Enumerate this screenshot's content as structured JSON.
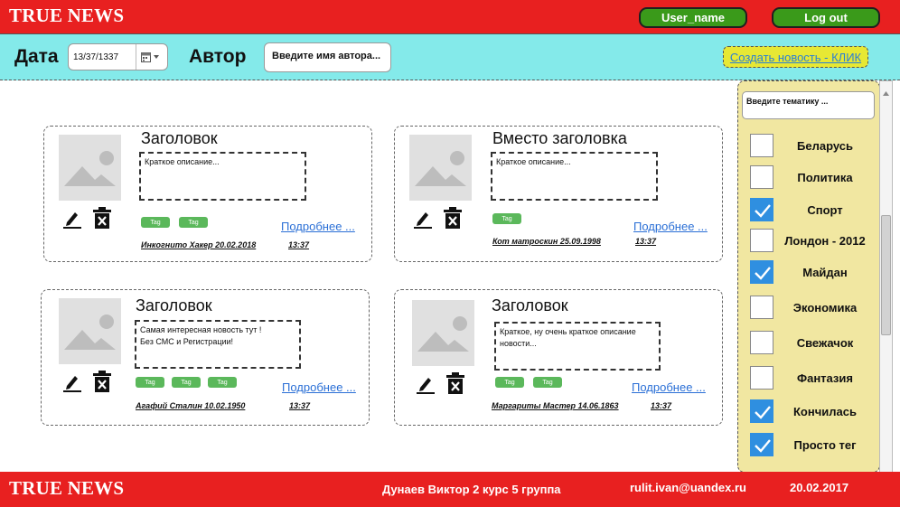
{
  "header": {
    "logo": "TRUE NEWS",
    "user_button": "User_name",
    "logout_button": "Log out"
  },
  "filters": {
    "date_label": "Дата",
    "date_value": "13/37/1337",
    "author_label": "Автор",
    "author_placeholder": "Введите имя автора...",
    "create_link": "Создать новость - КЛИК"
  },
  "cards": [
    {
      "title": "Заголовок",
      "desc_lines": [
        "Краткое описание...",
        ""
      ],
      "tags": [
        "Tag",
        "Tag"
      ],
      "more": "Подробнее ...",
      "author_date": "Инкогнито Хакер  20.02.2018",
      "time": "13:37"
    },
    {
      "title": "Вместо заголовка",
      "desc_lines": [
        "Краткое описание...",
        ""
      ],
      "tags": [
        "Tag"
      ],
      "more": "Подробнее ...",
      "author_date": "Кот матроскин   25.09.1998",
      "time": "13:37"
    },
    {
      "title": "Заголовок",
      "desc_lines": [
        "Самая интересная новость тут !",
        "Без СМС и Регистрации!"
      ],
      "tags": [
        "Tag",
        "Tag",
        "Tag"
      ],
      "more": "Подробнее ...",
      "author_date": "Агафий  Сталин  10.02.1950",
      "time": "13:37"
    },
    {
      "title": "Заголовок",
      "desc_lines": [
        "Краткое, ну очень краткое описание",
        "новости..."
      ],
      "tags": [
        "Tag",
        "Tag"
      ],
      "more": "Подробнее ...",
      "author_date": "Маргариты Мастер   14.06.1863",
      "time": "13:37"
    }
  ],
  "sidebar": {
    "topic_placeholder": "Введите тематику ...",
    "topics": [
      {
        "label": "Беларусь",
        "checked": false
      },
      {
        "label": "Политика",
        "checked": false
      },
      {
        "label": "Спорт",
        "checked": true
      },
      {
        "label": "Лондон - 2012",
        "checked": false
      },
      {
        "label": "Майдан",
        "checked": true
      },
      {
        "label": "Экономика",
        "checked": false
      },
      {
        "label": "Свежачок",
        "checked": false
      },
      {
        "label": "Фантазия",
        "checked": false
      },
      {
        "label": "Кончилась",
        "checked": true
      },
      {
        "label": "Просто тег",
        "checked": true
      }
    ]
  },
  "footer": {
    "logo": "TRUE NEWS",
    "author": "Дунаев Виктор  2 курс 5 группа",
    "email": "rulit.ivan@uandex.ru",
    "date": "20.02.2017"
  },
  "colors": {
    "header_bg": "#e82020",
    "filter_bg": "#84eaea",
    "sidebar_bg": "#f1e7a1",
    "button_green": "#3a9a1a",
    "checkbox_blue": "#2f8fe0",
    "tag_green": "#5bb85b",
    "link_blue": "#2a6fd6"
  }
}
